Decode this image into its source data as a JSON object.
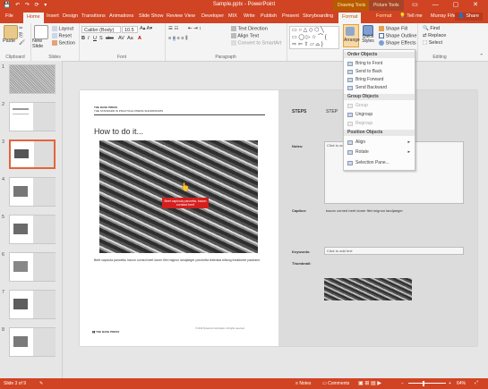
{
  "window": {
    "quick_access": "💾 ↶ ↷ ⟳ ▾",
    "title": "Sample.pptx - PowerPoint",
    "ctx_drawing": "Drawing Tools",
    "ctx_picture": "Picture Tools"
  },
  "tabs": {
    "file": "File",
    "home": "Home",
    "insert": "Insert",
    "design": "Design",
    "transitions": "Transitions",
    "animations": "Animations",
    "slideshow": "Slide Show",
    "review": "Review",
    "view": "View",
    "developer": "Developer",
    "mix": "MIX",
    "write": "Write",
    "publish": "Publish",
    "present": "Present",
    "storyboarding": "Storyboarding",
    "format1": "Format",
    "format2": "Format",
    "tellme": "Tell me",
    "user": "Murray Fife",
    "share": "Share"
  },
  "ribbon": {
    "paste": "Paste",
    "clipboard": "Clipboard",
    "new_slide": "New Slide",
    "layout": "Layout",
    "reset": "Reset",
    "section": "Section",
    "slides": "Slides",
    "font_name": "Calibri (Body)",
    "font_size": "10.5",
    "font": "Font",
    "paragraph": "Paragraph",
    "text_direction": "Text Direction",
    "align_text": "Align Text",
    "convert_smartart": "Convert to SmartArt",
    "arrange": "Arrange",
    "quick_styles": "Quick Styles",
    "shape_fill": "Shape Fill",
    "shape_outline": "Shape Outline",
    "shape_effects": "Shape Effects",
    "find": "Find",
    "replace": "Replace",
    "select": "Select",
    "editing": "Editing"
  },
  "menu": {
    "order_header": "Order Objects",
    "bring_front": "Bring to Front",
    "send_back": "Send to Back",
    "bring_forward": "Bring Forward",
    "send_backward": "Send Backward",
    "group_header": "Group Objects",
    "group": "Group",
    "ungroup": "Ungroup",
    "regroup": "Regroup",
    "position_header": "Position Objects",
    "align": "Align",
    "rotate": "Rotate",
    "selection_pane": "Selection Pane..."
  },
  "slides": [
    {
      "num": "1"
    },
    {
      "num": "2"
    },
    {
      "num": "3"
    },
    {
      "num": "4"
    },
    {
      "num": "5"
    },
    {
      "num": "6"
    },
    {
      "num": "7"
    },
    {
      "num": "8"
    }
  ],
  "slide": {
    "header_line1": "THE BASE PRESS",
    "header_line2": "THE STANDARD IN PRACTICAL PRESS SHOWROOMS",
    "title": "How to do it...",
    "callout": "Beef capicola pancetta, bacon cornkad beef",
    "caption": "Beef capicola pancetta, bacon corned beef doner filet mignon landjaeger porchetta leberkas biltong frankfurter pastrami.",
    "logo": "THE BASE PRESS",
    "footer": "© 2016 Dynamics Corporation. All rights reserved.",
    "steps": "STEPS",
    "step": "STEP",
    "notes_label": "Notes:",
    "notes_ph": "Click to add text",
    "caption_label": "Caption:",
    "caption_val": "bacon corned beef doner filet mignon landjaeger",
    "keywords_label": "Keywords:",
    "keywords_ph": "Click to add text",
    "thumb_label": "Thumbnail:"
  },
  "status": {
    "slide_of": "Slide 3 of 9",
    "notes": "Notes",
    "comments": "Comments",
    "zoom": "64%"
  },
  "colors": {
    "accent": "#d04423",
    "ribbon_bg": "#f4f4f4"
  }
}
